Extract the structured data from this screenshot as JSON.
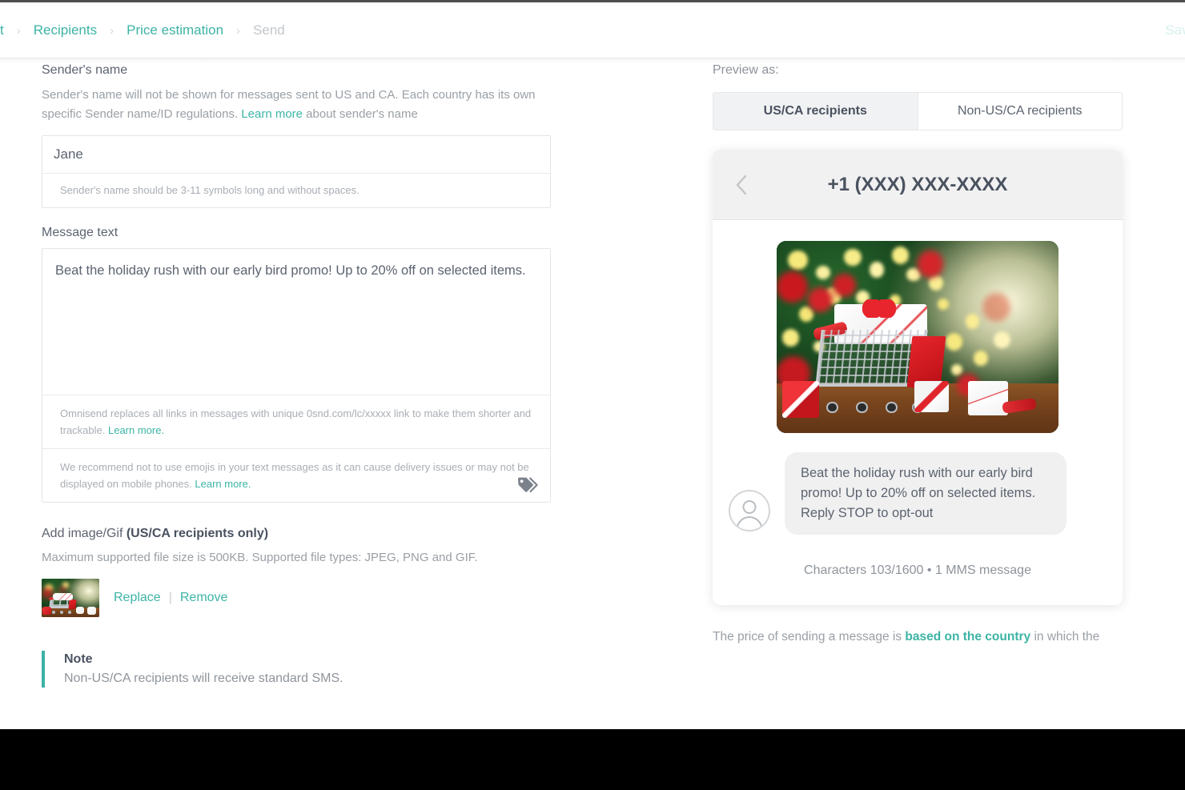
{
  "header": {
    "breadcrumb": [
      {
        "label": "t",
        "state": "active-cut"
      },
      {
        "label": "Recipients",
        "state": "active"
      },
      {
        "label": "Price estimation",
        "state": "active"
      },
      {
        "label": "Send",
        "state": "muted"
      }
    ],
    "separator": "›",
    "save_label": "Save"
  },
  "sender": {
    "label": "Sender's name",
    "description_before": "Sender's name will not be shown for messages sent to US and CA. Each country has its own specific Sender name/ID regulations. ",
    "learn_more": "Learn more",
    "description_after": " about sender's name",
    "value": "Jane",
    "placeholder": "Sender's name",
    "hint": "Sender's name should be 3-11 symbols long and without spaces."
  },
  "message": {
    "label": "Message text",
    "value": "Beat the holiday rush with our early bird promo! Up to 20% off on selected items.",
    "tag_icon": "tag-icon",
    "hint1_before": "Omnisend replaces all links in messages with unique 0snd.com/lc/xxxxx link to make them shorter and trackable. ",
    "hint1_link": "Learn more.",
    "hint2_before": "We recommend not to use emojis in your text messages as it can cause delivery issues or may not be displayed on mobile phones. ",
    "hint2_link": "Learn more."
  },
  "media": {
    "title_normal": "Add image/Gif ",
    "title_bold": "(US/CA recipients only)",
    "subtitle": "Maximum supported file size is 500KB. Supported file types: JPEG, PNG and GIF.",
    "replace_label": "Replace",
    "separator": "|",
    "remove_label": "Remove"
  },
  "note": {
    "title": "Note",
    "text": "Non-US/CA recipients will receive standard SMS."
  },
  "preview": {
    "label": "Preview as:",
    "tabs": [
      {
        "label": "US/CA recipients",
        "active": true
      },
      {
        "label": "Non-US/CA recipients",
        "active": false
      }
    ],
    "phone_number": "+1 (XXX) XXX-XXXX",
    "back_icon": "chevron-left-icon",
    "avatar_icon": "user-avatar-icon",
    "bubble_text": "Beat the holiday rush with our early bird promo! Up to 20% off on selected items. Reply STOP to opt-out",
    "char_count": "Characters 103/1600 • 1 MMS message",
    "price_before": "The price of sending a message is ",
    "price_link": "based on the country",
    "price_after": " in which the"
  },
  "colors": {
    "accent": "#3cb4a5",
    "text": "#5c6370",
    "muted": "#9aa0a6",
    "border": "#e3e5e8",
    "tab_active_bg": "#f1f2f3"
  }
}
